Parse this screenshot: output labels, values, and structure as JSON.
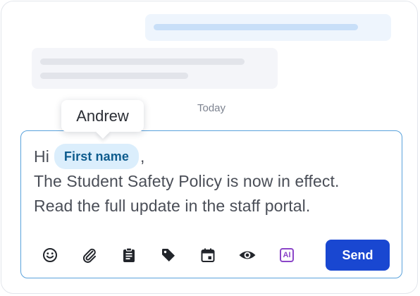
{
  "chat": {
    "date_separator": "Today"
  },
  "tooltip": {
    "text": "Andrew"
  },
  "composer": {
    "greeting": "Hi",
    "placeholder_chip": "First name",
    "after_chip": ",",
    "line2": "The Student Safety Policy is now in effect.",
    "line3": "Read the full update in the staff portal."
  },
  "toolbar": {
    "icons": [
      "emoji-icon",
      "attachment-icon",
      "clipboard-icon",
      "tag-icon",
      "calendar-icon",
      "preview-eye-icon",
      "ai-icon"
    ],
    "ai_label": "AI",
    "send_label": "Send"
  },
  "colors": {
    "accent": "#1947d1",
    "chip_bg": "#dbeefc",
    "chip_text": "#0e5c8e",
    "composer_border": "#5aa2db",
    "ai_purple": "#8b45c8"
  }
}
